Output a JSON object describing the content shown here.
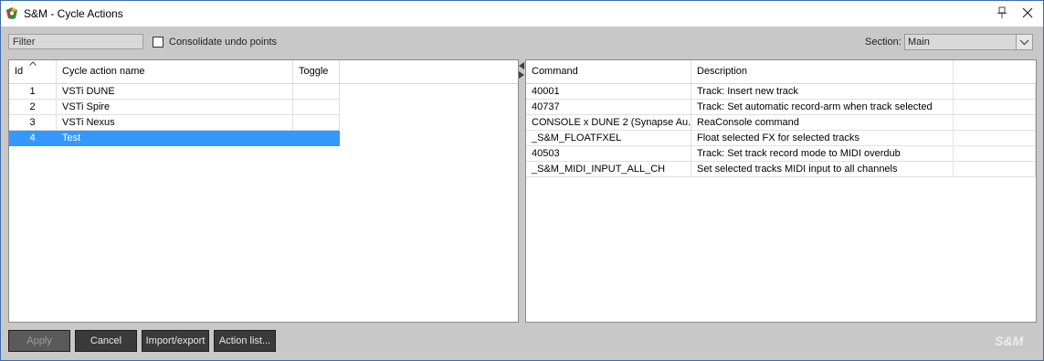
{
  "window": {
    "title": "S&M - Cycle Actions"
  },
  "toolbar": {
    "filter_placeholder": "Filter",
    "consolidate_label": "Consolidate undo points",
    "consolidate_checked": false,
    "section_label": "Section:",
    "section_value": "Main"
  },
  "left_table": {
    "headers": {
      "id": "Id",
      "name": "Cycle action name",
      "toggle": "Toggle"
    },
    "rows": [
      {
        "id": "1",
        "name": "VSTi DUNE",
        "toggle": ""
      },
      {
        "id": "2",
        "name": "VSTi Spire",
        "toggle": ""
      },
      {
        "id": "3",
        "name": "VSTi Nexus",
        "toggle": ""
      },
      {
        "id": "4",
        "name": "Test",
        "toggle": "",
        "selected": true
      }
    ]
  },
  "right_table": {
    "headers": {
      "command": "Command",
      "description": "Description"
    },
    "rows": [
      {
        "command": "40001",
        "description": "Track: Insert new track"
      },
      {
        "command": "40737",
        "description": "Track: Set automatic record-arm when track selected"
      },
      {
        "command": "CONSOLE x DUNE 2 (Synapse Au...",
        "description": "ReaConsole command"
      },
      {
        "command": "_S&M_FLOATFXEL",
        "description": "Float selected FX for selected tracks"
      },
      {
        "command": "40503",
        "description": "Track: Set track record mode to MIDI overdub"
      },
      {
        "command": "_S&M_MIDI_INPUT_ALL_CH",
        "description": "Set selected tracks MIDI input to all channels"
      }
    ]
  },
  "buttons": {
    "apply": "Apply",
    "cancel": "Cancel",
    "import_export": "Import/export",
    "action_list": "Action list..."
  },
  "branding": {
    "logo_text": "S&M"
  },
  "colors": {
    "selection": "#3399ff",
    "button_bg": "#3a3a3a",
    "window_bg": "#c8c8c8",
    "border": "#3d6ea8"
  }
}
